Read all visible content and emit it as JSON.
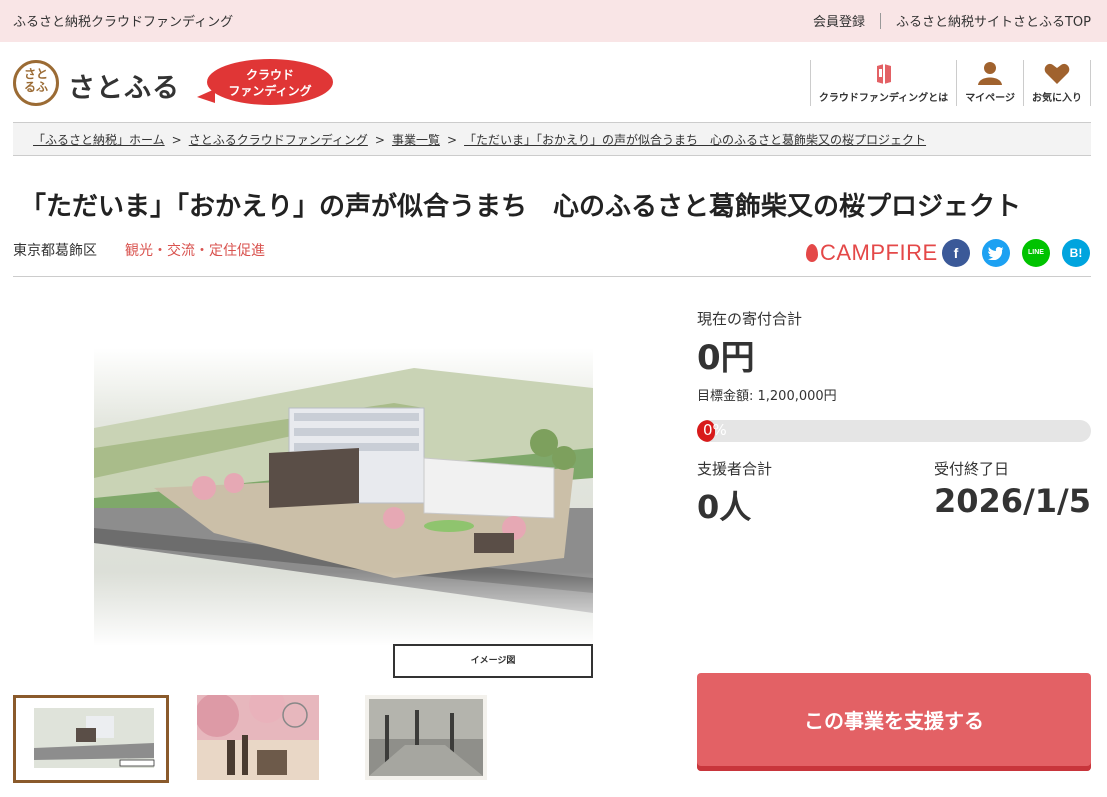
{
  "topbar": {
    "brand": "ふるさと納税クラウドファンディング",
    "links": [
      "会員登録",
      "ふるさと納税サイトさとふるTOP"
    ]
  },
  "header": {
    "logo_mark": "さと\nるふ",
    "logo_text": "さとふる",
    "badge_line1": "クラウド",
    "badge_line2": "ファンディング",
    "nav": [
      {
        "label": "クラウドファンディングとは",
        "icon": "book-icon"
      },
      {
        "label": "マイページ",
        "icon": "user-icon"
      },
      {
        "label": "お気に入り",
        "icon": "heart-icon"
      }
    ]
  },
  "breadcrumb": [
    "「ふるさと納税」ホーム",
    "さとふるクラウドファンディング",
    "事業一覧",
    "「ただいま」「おかえり」の声が似合うまち　心のふるさと葛飾柴又の桜プロジェクト"
  ],
  "breadcrumb_sep": ">",
  "project": {
    "title": "「ただいま」「おかえり」の声が似合うまち　心のふるさと葛飾柴又の桜プロジェクト",
    "location": "東京都葛飾区",
    "category": "観光・交流・定住促進",
    "platform": "CAMPFIRE",
    "image_caption": "イメージ図"
  },
  "social": [
    {
      "name": "facebook-icon",
      "glyph": "f",
      "color": "#3b5998"
    },
    {
      "name": "twitter-icon",
      "glyph": "t",
      "color": "#1da1f2"
    },
    {
      "name": "line-icon",
      "glyph": "LINE",
      "color": "#00c300"
    },
    {
      "name": "hatena-icon",
      "glyph": "B!",
      "color": "#00a4de"
    }
  ],
  "stats": {
    "total_label": "現在の寄付合計",
    "total_value": "0円",
    "goal_text": "目標金額: 1,200,000円",
    "progress_text": "0%",
    "progress_fraction": 0,
    "supporters_label": "支援者合計",
    "supporters_value": "0人",
    "deadline_label": "受付終了日",
    "deadline_value": "2026/1/5"
  },
  "cta": {
    "label": "この事業を支援する"
  },
  "colors": {
    "accent": "#e36165",
    "topbar_bg": "#f9e5e6",
    "category": "#d9534f"
  }
}
